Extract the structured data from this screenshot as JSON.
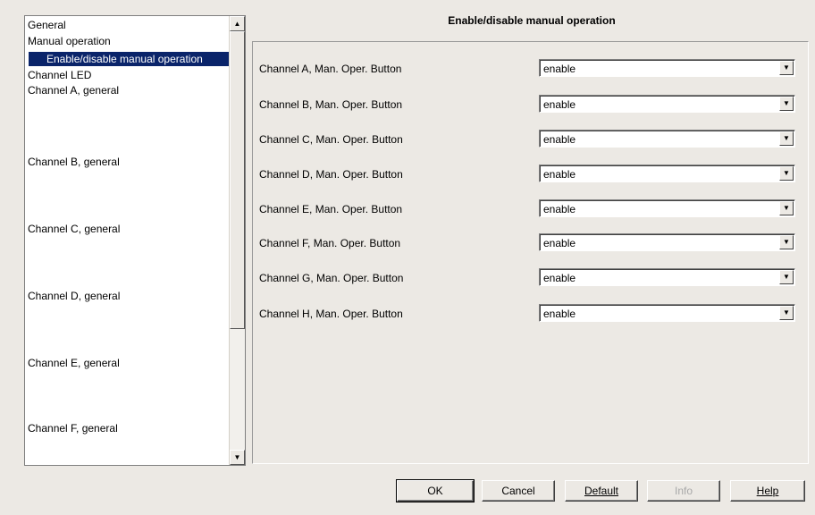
{
  "tree": {
    "items": [
      {
        "label": "General"
      },
      {
        "label": "Manual operation"
      },
      {
        "label": "Enable/disable manual operation",
        "selected": true
      },
      {
        "label": "Channel LED"
      },
      {
        "label": "Channel A, general"
      },
      {
        "label": "Channel B, general"
      },
      {
        "label": "Channel C, general"
      },
      {
        "label": "Channel D, general"
      },
      {
        "label": "Channel E, general"
      },
      {
        "label": "Channel F, general"
      }
    ]
  },
  "page": {
    "title": "Enable/disable manual operation",
    "params": [
      {
        "label": "Channel A, Man. Oper. Button",
        "value": "enable"
      },
      {
        "label": "Channel B, Man. Oper. Button",
        "value": "enable"
      },
      {
        "label": "Channel C, Man. Oper. Button",
        "value": "enable"
      },
      {
        "label": "Channel D, Man. Oper. Button",
        "value": "enable"
      },
      {
        "label": "Channel E, Man. Oper. Button",
        "value": "enable"
      },
      {
        "label": "Channel F, Man. Oper. Button",
        "value": "enable"
      },
      {
        "label": "Channel G, Man. Oper. Button",
        "value": "enable"
      },
      {
        "label": "Channel H, Man. Oper. Button",
        "value": "enable"
      }
    ]
  },
  "buttons": {
    "ok": "OK",
    "cancel": "Cancel",
    "default": "Default",
    "info": "Info",
    "help": "Help"
  },
  "icons": {
    "scroll_up": "scroll-up-arrow-icon",
    "scroll_down": "scroll-down-arrow-icon",
    "dropdown": "dropdown-arrow-icon"
  }
}
